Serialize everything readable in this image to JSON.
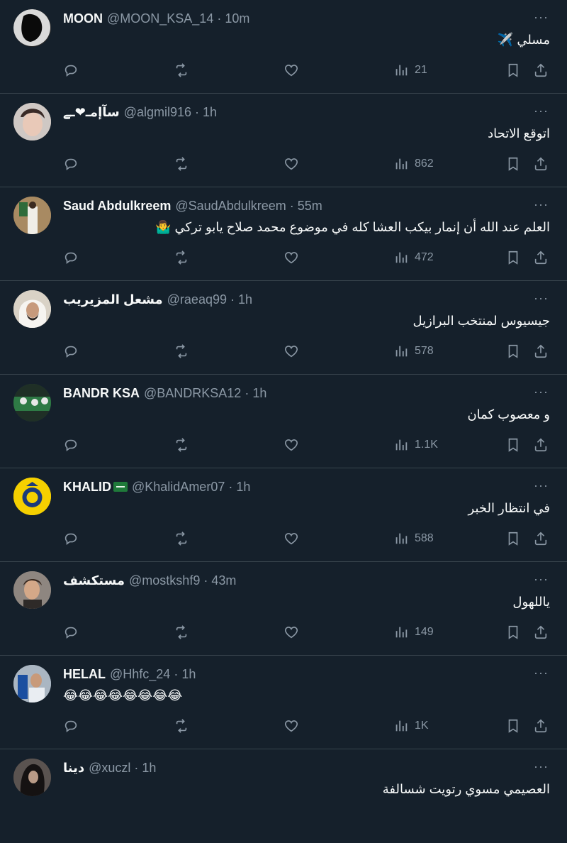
{
  "colors": {
    "background": "#15202b",
    "divider": "#38444d",
    "muted": "#8b98a5",
    "text": "#f7f9f9"
  },
  "tweets": [
    {
      "name": "MOON",
      "handle": "@MOON_KSA_14",
      "time": "10m",
      "text": "مسلي ✈️",
      "views": "21",
      "avatar_color": "#2a2a2a"
    },
    {
      "name": "سآإمـ❤ـے",
      "handle": "@algmil916",
      "time": "1h",
      "text": "اتوقع الاتحاد",
      "views": "862",
      "avatar_color": "#b8a59a"
    },
    {
      "name": "Saud Abdulkreem",
      "handle": "@SaudAbdulkreem",
      "time": "55m",
      "text": "العلم عند الله أن إنمار بيكب العشا كله في موضوع محمد صلاح يابو تركي 🤷‍♂️",
      "views": "472",
      "avatar_color": "#8a6d4a"
    },
    {
      "name": "مشعل المزيريب",
      "handle": "@raeaq99",
      "time": "1h",
      "text": "جيسيوس لمنتخب البرازيل",
      "views": "578",
      "avatar_color": "#e8e2d6"
    },
    {
      "name": "BANDR KSA",
      "handle": "@BANDRKSA12",
      "time": "1h",
      "text": "و معصوب كمان",
      "views": "1.1K",
      "avatar_color": "#2e5a3a"
    },
    {
      "name": "KHALID",
      "handle": "@KhalidAmer07",
      "time": "1h",
      "text": "في انتظار الخبر",
      "views": "588",
      "avatar_color": "#f5d000"
    },
    {
      "name": "مستكشف",
      "handle": "@mostkshf9",
      "time": "43m",
      "text": "ياللهول",
      "views": "149",
      "avatar_color": "#7a6a5e"
    },
    {
      "name": "HELAL",
      "handle": "@Hhfc_24",
      "time": "1h",
      "text": "😂😂😂😂😂😂😂😂",
      "views": "1K",
      "avatar_color": "#9aa7b4"
    },
    {
      "name": "دينا",
      "handle": "@xuczl",
      "time": "1h",
      "text": "العصيمي مسوي رتويت شسالفة",
      "views": "",
      "avatar_color": "#3a3230"
    }
  ],
  "icons": {
    "reply": "reply-icon",
    "retweet": "retweet-icon",
    "like": "like-icon",
    "views": "views-icon",
    "bookmark": "bookmark-icon",
    "share": "share-icon",
    "more": "more-icon"
  }
}
